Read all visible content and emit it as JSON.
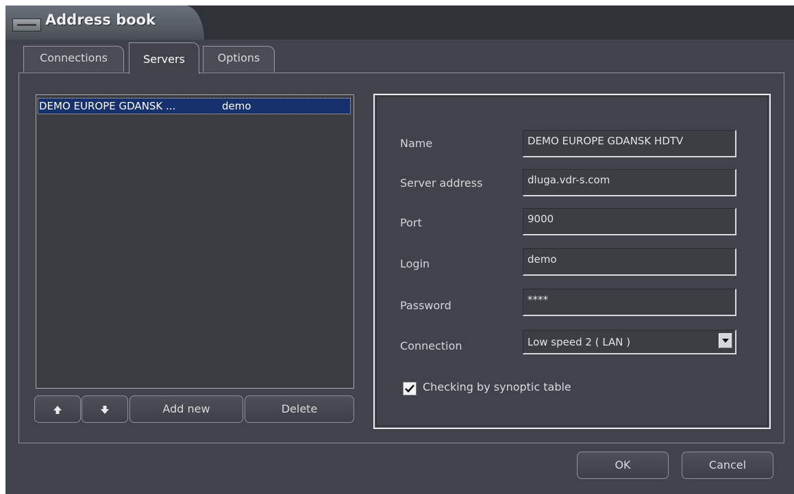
{
  "window": {
    "title": "Address book"
  },
  "tabs": [
    {
      "label": "Connections",
      "active": false
    },
    {
      "label": "Servers",
      "active": true
    },
    {
      "label": "Options",
      "active": false
    }
  ],
  "server_list": {
    "rows": [
      {
        "name": "DEMO EUROPE GDANSK ...",
        "login": "demo",
        "selected": true
      }
    ]
  },
  "list_buttons": {
    "move_up_icon": "arrow-up-icon",
    "move_down_icon": "arrow-down-icon",
    "add_new": "Add new",
    "delete": "Delete"
  },
  "form": {
    "name_label": "Name",
    "name_value": "DEMO EUROPE GDANSK HDTV",
    "address_label": "Server address",
    "address_value": "dluga.vdr-s.com",
    "port_label": "Port",
    "port_value": "9000",
    "login_label": "Login",
    "login_value": "demo",
    "password_label": "Password",
    "password_value": "****",
    "connection_label": "Connection",
    "connection_value": "Low speed 2 ( LAN )",
    "checkbox_label": "Checking by synoptic table",
    "checkbox_checked": true
  },
  "dialog_buttons": {
    "ok": "OK",
    "cancel": "Cancel"
  },
  "colors": {
    "window_bg": "#40444a",
    "selection": "#17306e",
    "text": "#d6d9dc"
  }
}
